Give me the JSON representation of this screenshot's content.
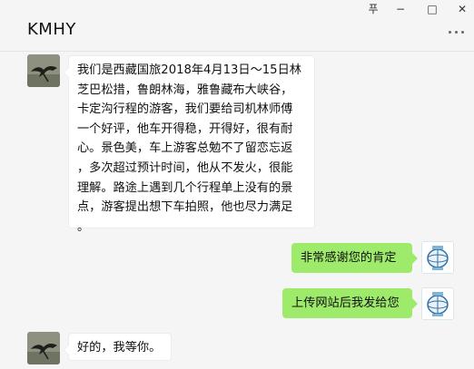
{
  "window": {
    "title": "KMHY",
    "controls": {
      "pin": "푸",
      "minimize": "−",
      "maximize": "□",
      "close": "✕"
    },
    "more_icon": "more-dots-icon"
  },
  "messages": [
    {
      "side": "left",
      "avatar": "bird-photo-avatar",
      "lines": [
        "我们是西藏国旅2018年4月13日～15日林",
        "芝巴松措，鲁朗林海，雅鲁藏布大峡谷，",
        "卡定沟行程的游客，我们要给司机林师傅",
        "一个好评，他车开得稳，开得好，很有耐",
        "心。景色美，车上游客总勉不了留恋忘返",
        "，多次超过预计时间，他从不发火，很能",
        "理解。路途上遇到几个行程单上没有的景",
        "点，游客提出想下车拍照，他也尽力满足",
        "。"
      ]
    },
    {
      "side": "right",
      "avatar": "company-logo-avatar",
      "text": "非常感谢您的肯定"
    },
    {
      "side": "right",
      "avatar": "company-logo-avatar",
      "text": "上传网站后我发给您"
    },
    {
      "side": "left",
      "avatar": "bird-photo-avatar",
      "text": "好的，我等你。"
    }
  ],
  "colors": {
    "background": "#f5f5f5",
    "bubble_self": "#9eea6a",
    "bubble_other": "#ffffff"
  }
}
